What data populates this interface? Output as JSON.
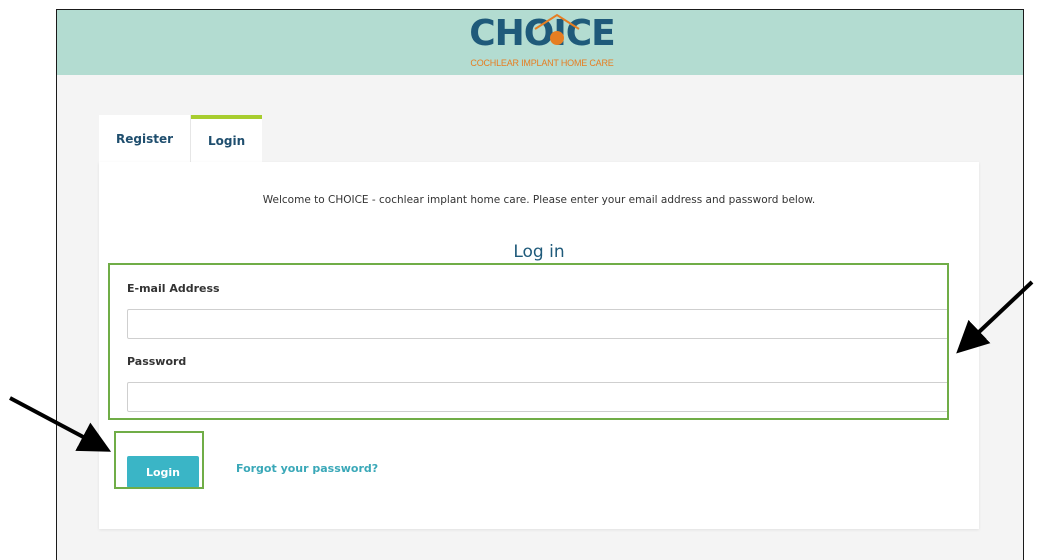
{
  "header": {
    "logo_text": "CHOICE",
    "logo_tagline": "COCHLEAR IMPLANT HOME CARE"
  },
  "tabs": [
    {
      "label": "Register",
      "active": false
    },
    {
      "label": "Login",
      "active": true
    }
  ],
  "main": {
    "welcome_text": "Welcome to CHOICE - cochlear implant home care. Please enter your email address and password below.",
    "heading": "Log in"
  },
  "form": {
    "email_label": "E-mail Address",
    "email_value": "",
    "password_label": "Password",
    "password_value": "",
    "login_button": "Login",
    "forgot_link": "Forgot your password?"
  },
  "colors": {
    "header_bg": "#b3dcd1",
    "brand_dark": "#1f5a7a",
    "brand_orange": "#e67e22",
    "tab_active_accent": "#a7cd2e",
    "button_bg": "#3ab5c6",
    "highlight_box": "#70ad47"
  }
}
